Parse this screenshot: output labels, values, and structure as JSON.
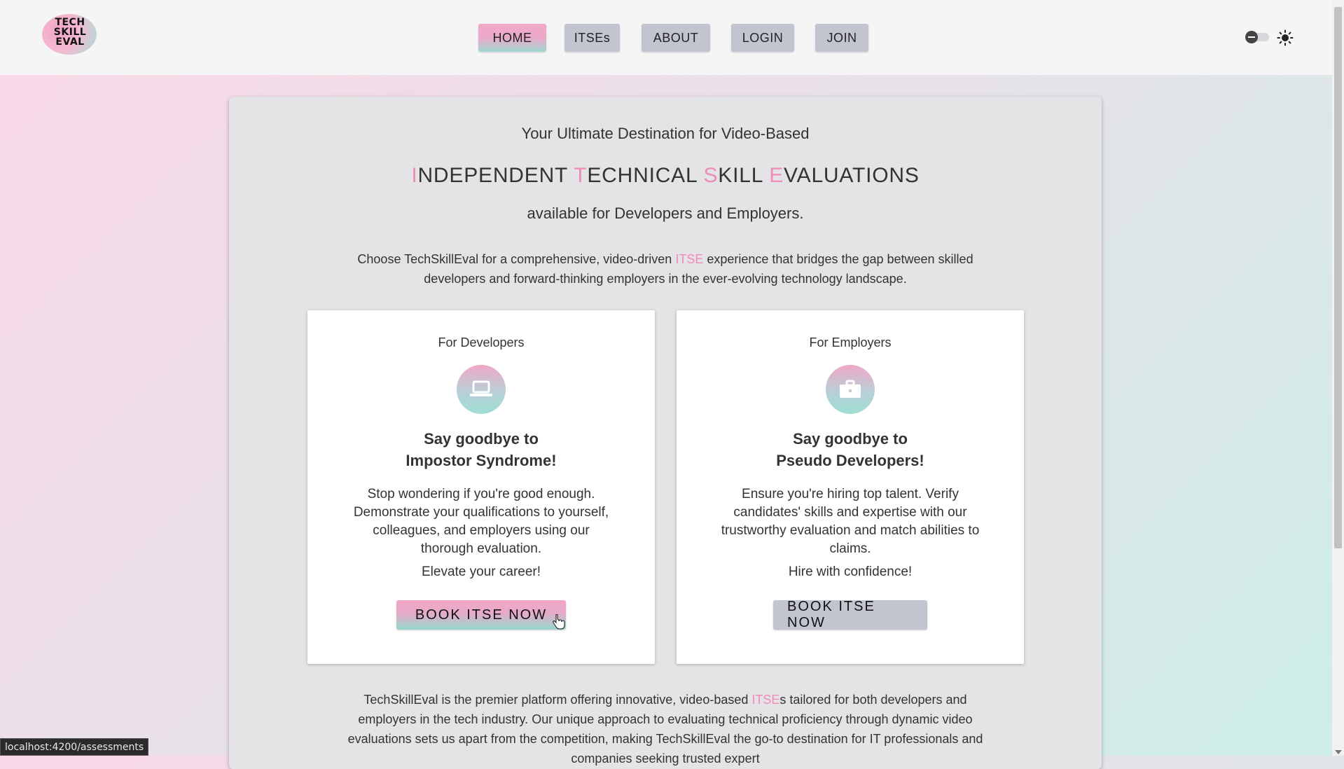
{
  "logo": {
    "text_line1": "TECH",
    "text_line2": "SKILL",
    "text_line3": "EVAL"
  },
  "nav": [
    {
      "label": "HOME",
      "active": true
    },
    {
      "label": "ITSEs",
      "active": false
    },
    {
      "label": "ABOUT",
      "active": false
    },
    {
      "label": "LOGIN",
      "active": false
    },
    {
      "label": "JOIN",
      "active": false
    }
  ],
  "theme": {
    "toggle_icon": "minus-circle-icon",
    "mode_icon": "sun-icon"
  },
  "hero": {
    "tagline": "Your Ultimate Destination for Video-Based",
    "headline": [
      {
        "accent": "I",
        "rest": "NDEPENDENT "
      },
      {
        "accent": "T",
        "rest": "ECHNICAL "
      },
      {
        "accent": "S",
        "rest": "KILL "
      },
      {
        "accent": "E",
        "rest": "VALUATIONS"
      }
    ],
    "subline": "available for Developers and Employers.",
    "intro_before": "Choose TechSkillEval for a comprehensive, video-driven ",
    "intro_highlight": "ITSE",
    "intro_after": " experience that bridges the gap between skilled developers and forward-thinking employers in the ever-evolving technology landscape."
  },
  "developers": {
    "label": "For Developers",
    "icon": "laptop-icon",
    "title_line1": "Say goodbye to",
    "title_line2": "Impostor Syndrome!",
    "body": "Stop wondering if you're good enough. Demonstrate your qualifications to yourself, colleagues, and employers using our thorough evaluation.",
    "cta": "Elevate your career!",
    "button": "BOOK ITSE NOW"
  },
  "employers": {
    "label": "For Employers",
    "icon": "briefcase-icon",
    "title_line1": "Say goodbye to",
    "title_line2": "Pseudo Developers!",
    "body": "Ensure you're hiring top talent. Verify candidates' skills and expertise with our trustworthy evaluation and match abilities to claims.",
    "cta": "Hire with confidence!",
    "button": "BOOK ITSE NOW"
  },
  "footer": {
    "before": "TechSkillEval is the premier platform offering innovative, video-based ",
    "highlight": "ITSE",
    "after": "s tailored for both developers and employers in the tech industry. Our unique approach to evaluating technical proficiency through dynamic video evaluations sets us apart from the competition, making TechSkillEval the go-to destination for IT professionals and companies seeking trusted expert"
  },
  "status_bar": {
    "url": "localhost:4200/assessments"
  },
  "colors": {
    "accent_pink": "#f08cb5",
    "accent_teal": "#9fd8cf",
    "button_gray": "#c2c4cf",
    "panel_bg": "#e4e3e6"
  }
}
